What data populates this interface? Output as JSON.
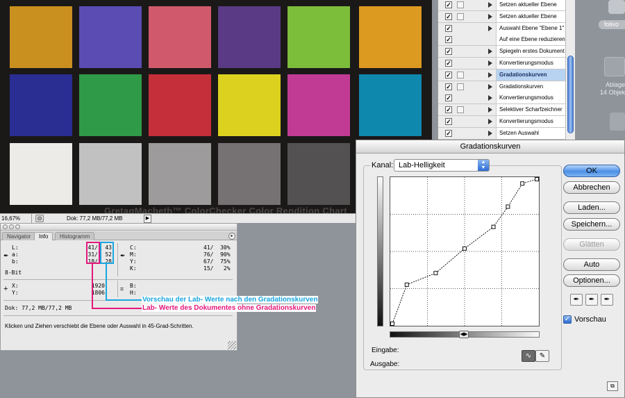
{
  "document": {
    "chart_caption": "GretagMacbeth™ ColorChecker Color Rendition Chart",
    "zoom": "16,67%",
    "doc_size": "Dok: 77,2 MB/77,2 MB",
    "patch_colors": [
      "#c98f1f",
      "#5a4cb3",
      "#d05a6c",
      "#5a3a85",
      "#7cbe3a",
      "#dd9a20",
      "#2a2d92",
      "#2f9a48",
      "#c42f3a",
      "#dcd11f",
      "#c13b95",
      "#0f88ae",
      "#ecebe8",
      "#c2c1c1",
      "#9e9b9c",
      "#767273",
      "#545152",
      "#2f2c2d"
    ]
  },
  "actions": {
    "rows": [
      {
        "label": "Setzen aktueller Ebene",
        "checked": true,
        "box2": true,
        "triangle": true,
        "selected": false
      },
      {
        "label": "Setzen aktueller Ebene",
        "checked": true,
        "box2": true,
        "triangle": true,
        "selected": false
      },
      {
        "label": "Auswahl Ebene \"Ebene 1\"",
        "checked": true,
        "box2": false,
        "triangle": true,
        "selected": false
      },
      {
        "label": "Auf eine Ebene reduzieren",
        "checked": true,
        "box2": false,
        "triangle": false,
        "selected": false
      },
      {
        "label": "Spiegeln erstes Dokument",
        "checked": true,
        "box2": false,
        "triangle": true,
        "selected": false
      },
      {
        "label": "Konvertierungsmodus",
        "checked": true,
        "box2": false,
        "triangle": true,
        "selected": false
      },
      {
        "label": "Gradationskurven",
        "checked": true,
        "box2": true,
        "triangle": true,
        "selected": true
      },
      {
        "label": "Gradationskurven",
        "checked": true,
        "box2": true,
        "triangle": true,
        "selected": false
      },
      {
        "label": "Konvertierungsmodus",
        "checked": true,
        "box2": false,
        "triangle": true,
        "selected": false
      },
      {
        "label": "Selektiver Scharfzeichner",
        "checked": true,
        "box2": true,
        "triangle": true,
        "selected": false
      },
      {
        "label": "Konvertierungsmodus",
        "checked": true,
        "box2": false,
        "triangle": true,
        "selected": false
      },
      {
        "label": "Setzen Auswahl",
        "checked": true,
        "box2": false,
        "triangle": true,
        "selected": false
      }
    ]
  },
  "desktop": {
    "item1_label": "folivo",
    "item2_label": "Ablage\n14 Objek"
  },
  "info": {
    "tabs": [
      "Navigator",
      "Info",
      "Histogramm"
    ],
    "lab_labels": "L:\na:\nb:",
    "lab_values": "41/\n31/\n18/",
    "lab_preview": "43\n52\n28",
    "bit_left": "8-Bit",
    "cmyk_labels": "C:\nM:\nY:\nK:",
    "cmyk_values": "41/  30%\n76/  90%\n67/  75%\n15/   2%",
    "xy_labels": "X:\nY:",
    "xy_values": "1920\n1806",
    "bh_labels": "B:\nH:",
    "doc_size": "Dok: 77,2 MB/77,2 MB",
    "hint": "Klicken und Ziehen verschiebt die Ebene oder Auswahl in 45-Grad-Schritten."
  },
  "annotations": {
    "preview_label": "Vorschau der Lab- Werte nach den Gradationskurven",
    "doc_label": "Lab- Werte des Dokumentes ohne Gradationskurven",
    "preview_color": "#19a6e0",
    "doc_color": "#e4177b"
  },
  "curves": {
    "title": "Gradationskurven",
    "channel_label": "Kanal:",
    "channel_value": "Lab-Helligkeit",
    "input_label": "Eingabe:",
    "output_label": "Ausgabe:",
    "buttons": {
      "ok": "OK",
      "cancel": "Abbrechen",
      "load": "Laden...",
      "save": "Speichern...",
      "smooth": "Glätten",
      "auto": "Auto",
      "options": "Optionen..."
    },
    "preview_label": "Vorschau",
    "preview_checked": true,
    "curve_points": [
      [
        0,
        0
      ],
      [
        0.1,
        0.27
      ],
      [
        0.3,
        0.35
      ],
      [
        0.5,
        0.52
      ],
      [
        0.7,
        0.67
      ],
      [
        0.8,
        0.81
      ],
      [
        0.9,
        0.97
      ],
      [
        1,
        1
      ]
    ]
  }
}
